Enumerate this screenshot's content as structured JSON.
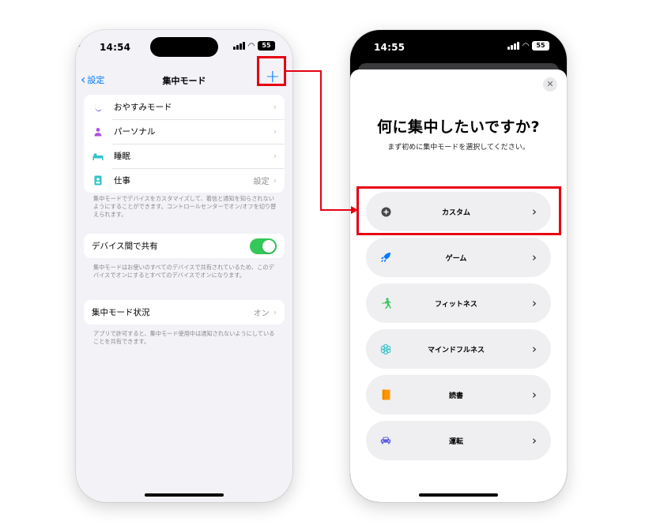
{
  "left_phone": {
    "status": {
      "time": "14:54",
      "battery": "55"
    },
    "nav": {
      "back_label": "設定",
      "title": "集中モード",
      "add_icon": "+"
    },
    "focus_list": [
      {
        "label": "おやすみモード",
        "value": "",
        "icon": "moon-icon",
        "color": "#5e5ce6"
      },
      {
        "label": "パーソナル",
        "value": "",
        "icon": "person-icon",
        "color": "#af52de"
      },
      {
        "label": "睡眠",
        "value": "",
        "icon": "bed-icon",
        "color": "#30c4c9"
      },
      {
        "label": "仕事",
        "value": "設定",
        "icon": "id-badge-icon",
        "color": "#30c4c9"
      }
    ],
    "focus_note": "集中モードでデバイスをカスタマイズして、着信と通知を知らされないようにすることができます。コントロールセンターでオン/オフを切り替えられます。",
    "share": {
      "label": "デバイス間で共有",
      "enabled": true
    },
    "share_note": "集中モードはお使いのすべてのデバイスで共有されているため、このデバイスでオンにするとすべてのデバイスでオンになります。",
    "status_row": {
      "label": "集中モード状況",
      "value": "オン"
    },
    "status_note": "アプリで許可すると、集中モード使用中は通知されないようにしていることを共有できます。"
  },
  "right_phone": {
    "status": {
      "time": "14:55",
      "battery": "55"
    },
    "close_icon": "✕",
    "title": "何に集中したいですか?",
    "subtitle": "まず初めに集中モードを選択してください。",
    "options": [
      {
        "label": "カスタム",
        "icon": "plus-circle-icon",
        "color": "#48484a"
      },
      {
        "label": "ゲーム",
        "icon": "rocket-icon",
        "color": "#007aff"
      },
      {
        "label": "フィットネス",
        "icon": "running-icon",
        "color": "#34c759"
      },
      {
        "label": "マインドフルネス",
        "icon": "flower-icon",
        "color": "#30c4c9"
      },
      {
        "label": "読書",
        "icon": "book-icon",
        "color": "#ff9500"
      },
      {
        "label": "運転",
        "icon": "car-icon",
        "color": "#5e5ce6"
      }
    ]
  },
  "annotation": {
    "color": "#e60012"
  }
}
